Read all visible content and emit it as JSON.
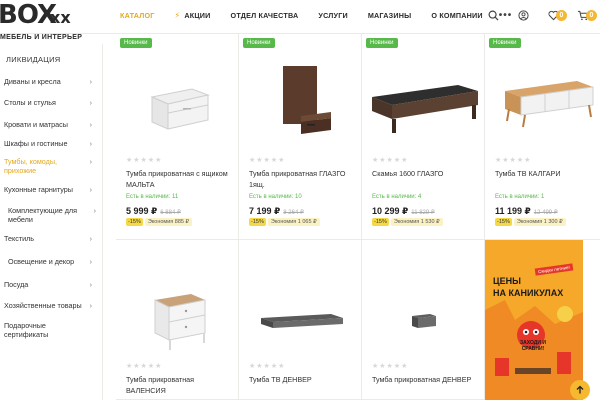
{
  "logo": {
    "main": "BOX",
    "x": "xx",
    "sub": "МЕБЕЛЬ И ИНТЕРЬЕР"
  },
  "nav": {
    "items": [
      "КАТАЛОГ",
      "АКЦИИ",
      "ОТДЕЛ КАЧЕСТВА",
      "УСЛУГИ",
      "МАГАЗИНЫ",
      "О КОМПАНИИ"
    ],
    "more": "•••"
  },
  "header": {
    "wishlist_count": "0",
    "cart_count": "0"
  },
  "sidebar": {
    "top": "ЛИКВИДАЦИЯ",
    "items": [
      "Диваны и кресла",
      "Столы и стулья",
      "Кровати и матрасы",
      "Шкафы и гостиные",
      "Тумбы, комоды, прихожие",
      "Кухонные гарнитуры",
      "Комплектующие для мебели",
      "Текстиль",
      "Освещение и декор",
      "Посуда",
      "Хозяйственные товары",
      "Подарочные сертификаты"
    ]
  },
  "products": [
    {
      "tag": "Новинки",
      "stars": "★★★★★",
      "name": "Тумба прикроватная с ящиком МАЛЬТА",
      "stock": "Есть в наличии: 11",
      "price": "5 999 ₽",
      "old": "6 884 ₽",
      "pct": "-15%",
      "eco": "Экономия 885 ₽"
    },
    {
      "tag": "Новинки",
      "stars": "★★★★★",
      "name": "Тумба прикроватная ГЛАЗГО 1ящ.",
      "stock": "Есть в наличии: 10",
      "price": "7 199 ₽",
      "old": "8 264 ₽",
      "pct": "-15%",
      "eco": "Экономия 1 065 ₽"
    },
    {
      "tag": "Новинки",
      "stars": "★★★★★",
      "name": "Скамья 1600 ГЛАЗГО",
      "stock": "Есть в наличии: 4",
      "price": "10 299 ₽",
      "old": "11 829 ₽",
      "pct": "-15%",
      "eco": "Экономия 1 530 ₽"
    },
    {
      "tag": "Новинки",
      "stars": "★★★★★",
      "name": "Тумба ТВ КАЛГАРИ",
      "stock": "Есть в наличии: 1",
      "price": "11 199 ₽",
      "old": "12 499 ₽",
      "pct": "-15%",
      "eco": "Экономия 1 300 ₽"
    },
    {
      "stars": "★★★★★",
      "name": "Тумба прикроватная ВАЛЕНСИЯ"
    },
    {
      "stars": "★★★★★",
      "name": "Тумба ТВ ДЕНВЕР"
    },
    {
      "stars": "★★★★★",
      "name": "Тумба прикроватная ДЕНВЕР"
    }
  ],
  "banner": {
    "title1": "ЦЕНЫ",
    "title2": "НА КАНИКУЛАХ",
    "sticker": "Скидки летние!",
    "cta": "ЗАХОДИ И СРАВНИ!"
  },
  "colors": {
    "accent": "#e2a91f",
    "new_tag": "#57b94a",
    "badge": "#f5b82e"
  }
}
